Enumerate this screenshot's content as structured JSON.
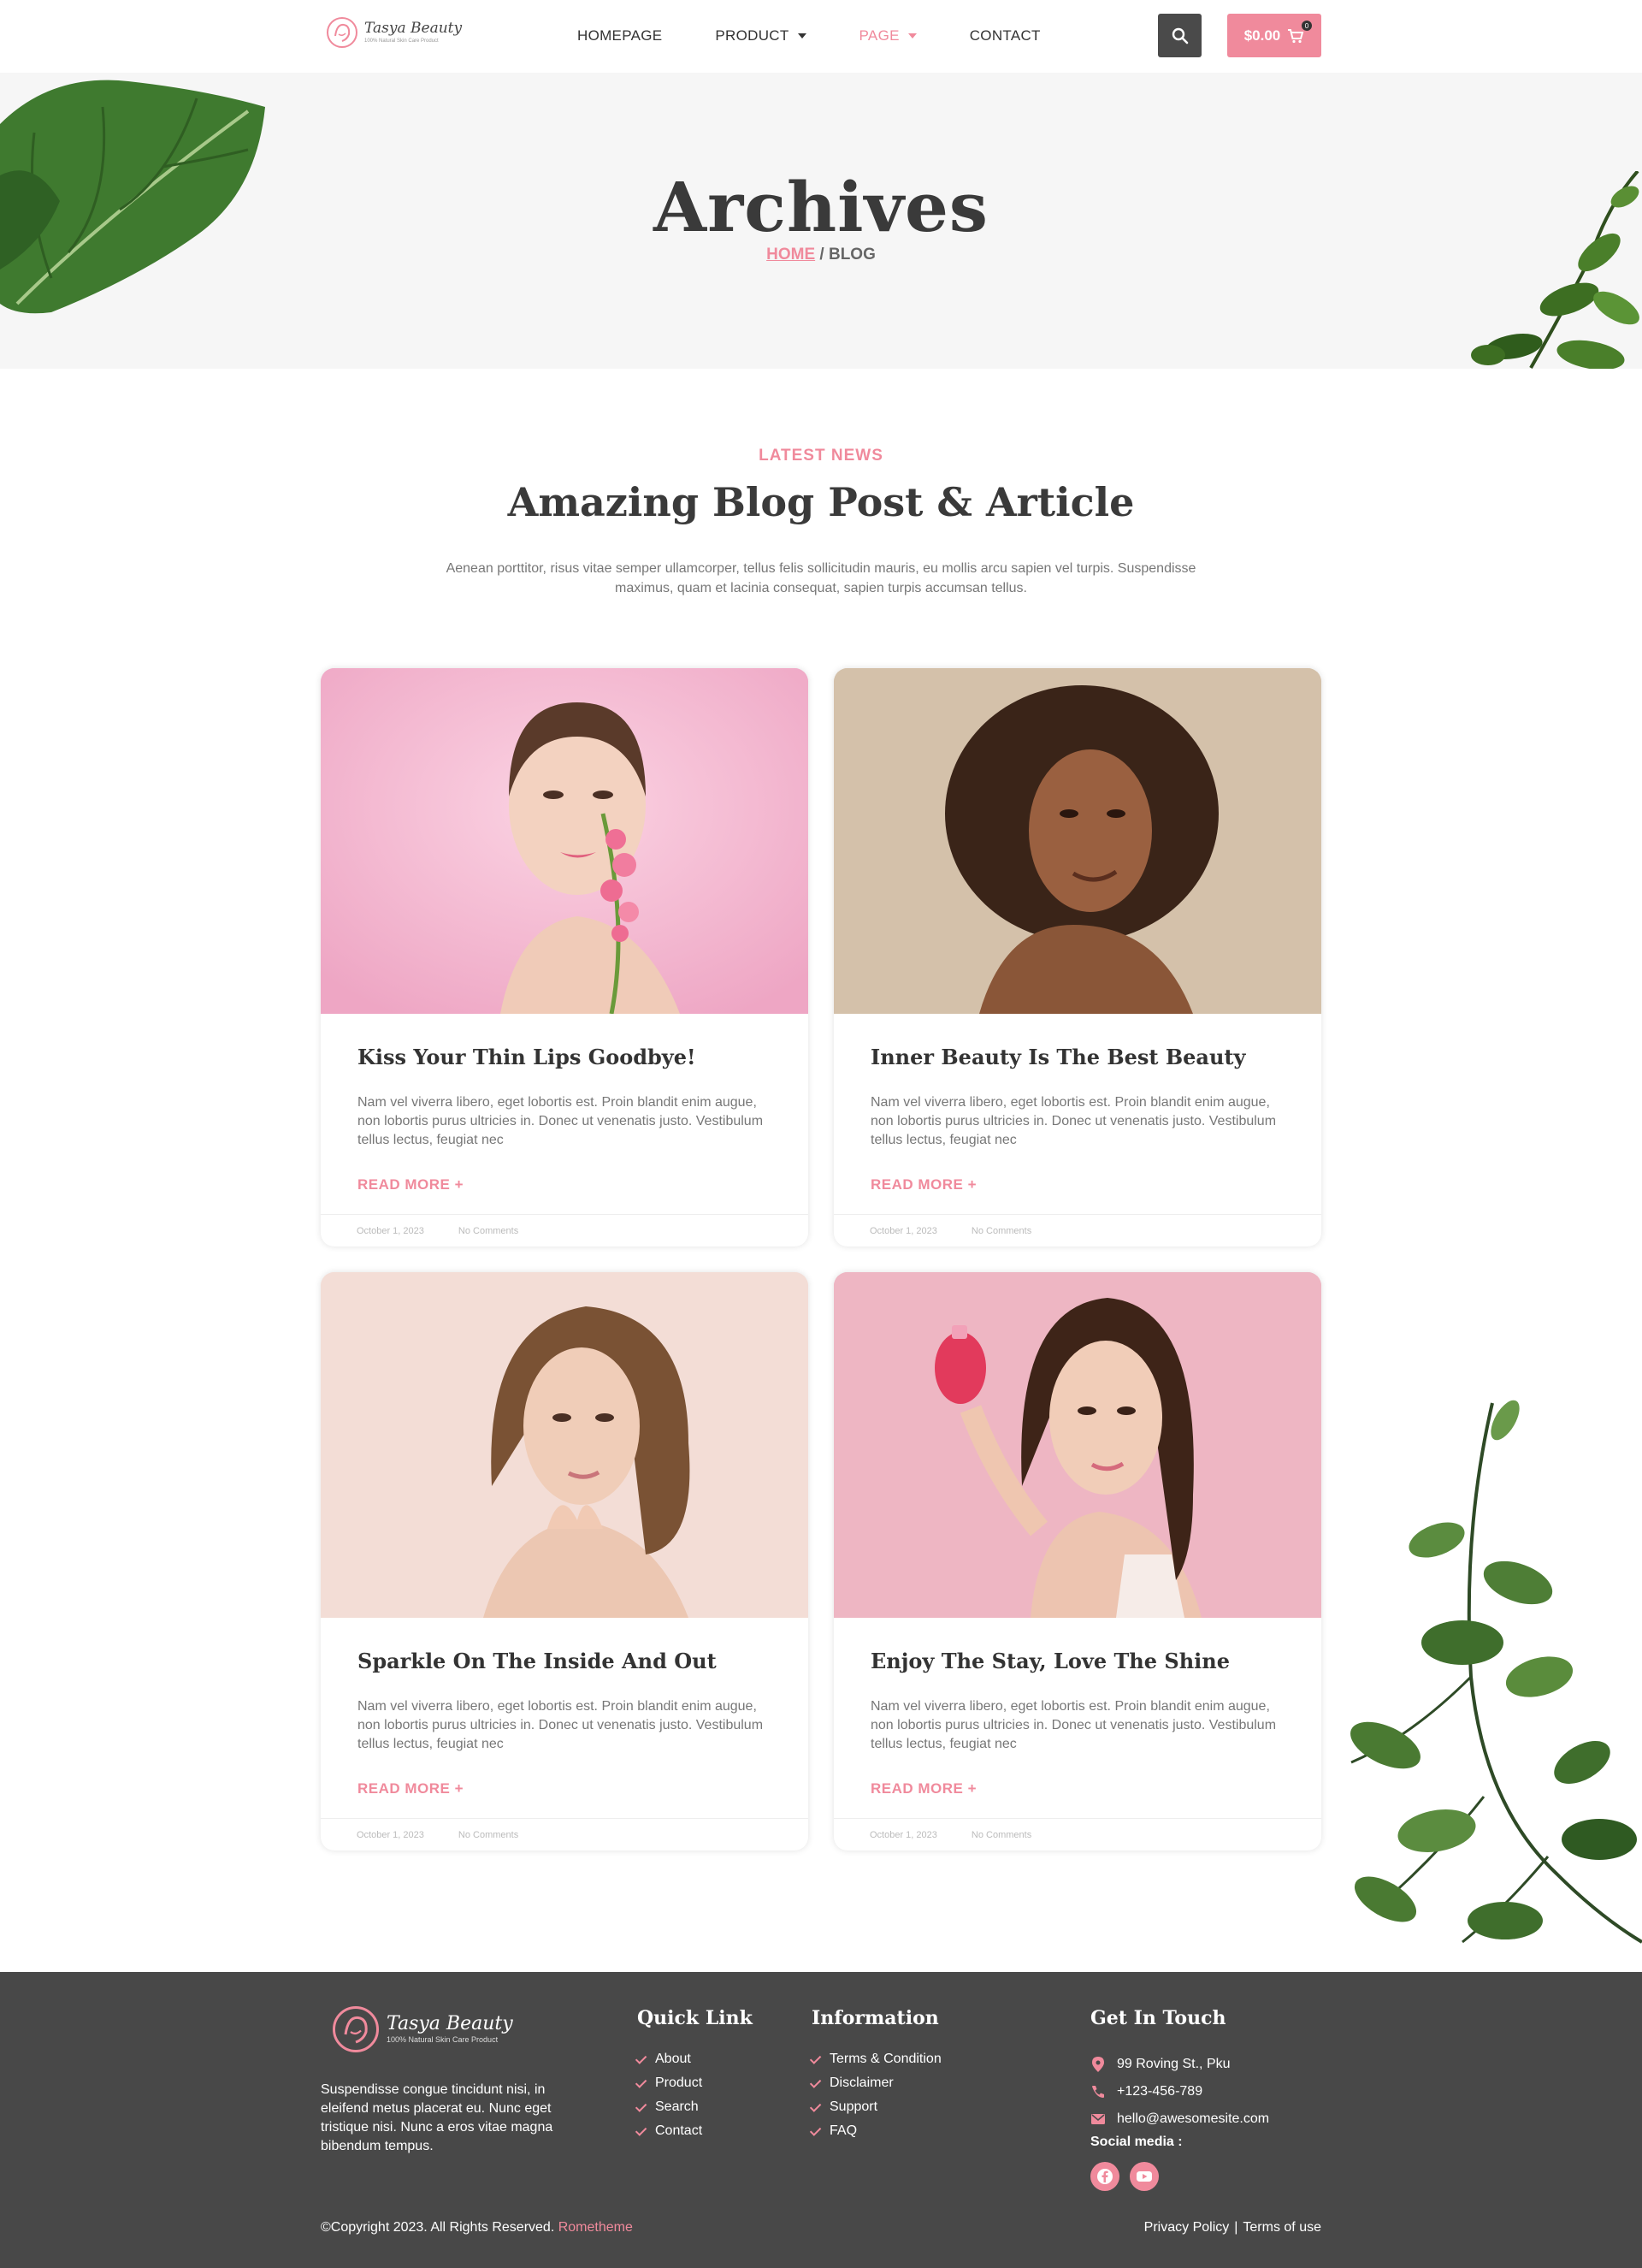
{
  "brand": {
    "name": "Tasya Beauty",
    "tagline": "100% Natural Skin Care Product",
    "accent": "#f08a9c",
    "dark": "#484848"
  },
  "nav": {
    "items": [
      {
        "label": "HOMEPAGE",
        "has_dropdown": false,
        "active": false
      },
      {
        "label": "PRODUCT",
        "has_dropdown": true,
        "active": false
      },
      {
        "label": "PAGE",
        "has_dropdown": true,
        "active": true
      },
      {
        "label": "CONTACT",
        "has_dropdown": false,
        "active": false
      }
    ],
    "search_icon": "search-icon",
    "cart": {
      "total": "$0.00",
      "count": "0",
      "icon": "cart-icon"
    }
  },
  "hero": {
    "title": "Archives",
    "breadcrumb": {
      "home": "HOME",
      "separator": " / ",
      "current": "BLOG"
    }
  },
  "section": {
    "eyebrow": "LATEST NEWS",
    "title": "Amazing Blog Post & Article",
    "description": "Aenean porttitor, risus vitae semper ullamcorper, tellus felis sollicitudin mauris, eu mollis arcu sapien vel turpis. Suspendisse maximus, quam et lacinia consequat, sapien turpis accumsan tellus."
  },
  "posts": [
    {
      "title": "Kiss Your Thin Lips Goodbye!",
      "excerpt": "Nam vel viverra libero, eget lobortis est. Proin blandit enim augue, non lobortis purus ultricies in. Donec ut venenatis justo. Vestibulum tellus lectus, feugiat nec",
      "read_more": "READ MORE +",
      "date": "October 1, 2023",
      "comments": "No Comments",
      "bg": "#f2b8cf"
    },
    {
      "title": "Inner Beauty Is The Best Beauty",
      "excerpt": "Nam vel viverra libero, eget lobortis est. Proin blandit enim augue, non lobortis purus ultricies in. Donec ut venenatis justo. Vestibulum tellus lectus, feugiat nec",
      "read_more": "READ MORE +",
      "date": "October 1, 2023",
      "comments": "No Comments",
      "bg": "#d6c3ad"
    },
    {
      "title": "Sparkle On The Inside And Out",
      "excerpt": "Nam vel viverra libero, eget lobortis est. Proin blandit enim augue, non lobortis purus ultricies in. Donec ut venenatis justo. Vestibulum tellus lectus, feugiat nec",
      "read_more": "READ MORE +",
      "date": "October 1, 2023",
      "comments": "No Comments",
      "bg": "#f3ddd7"
    },
    {
      "title": "Enjoy The Stay, Love The Shine",
      "excerpt": "Nam vel viverra libero, eget lobortis est. Proin blandit enim augue, non lobortis purus ultricies in. Donec ut venenatis justo. Vestibulum tellus lectus, feugiat nec",
      "read_more": "READ MORE +",
      "date": "October 1, 2023",
      "comments": "No Comments",
      "bg": "#eeb2c0"
    }
  ],
  "footer": {
    "about": "Suspendisse congue tincidunt nisi, in eleifend metus placerat eu. Nunc eget tristique nisi. Nunc a eros vitae magna bibendum tempus.",
    "quick_link": {
      "title": "Quick Link",
      "items": [
        "About",
        "Product",
        "Search",
        "Contact"
      ]
    },
    "information": {
      "title": "Information",
      "items": [
        "Terms & Condition",
        "Disclaimer",
        "Support",
        "FAQ"
      ]
    },
    "contact": {
      "title": "Get In Touch",
      "address": "99 Roving St., Pku",
      "phone": "+123-456-789",
      "email": "hello@awesomesite.com",
      "social_label": "Social media :",
      "socials": [
        "facebook-icon",
        "youtube-icon"
      ]
    },
    "copyright": "©Copyright 2023. All Rights Reserved.",
    "copyright_brand": "Rometheme",
    "privacy": "Privacy Policy",
    "legal_sep": "|",
    "terms": "Terms of use"
  }
}
